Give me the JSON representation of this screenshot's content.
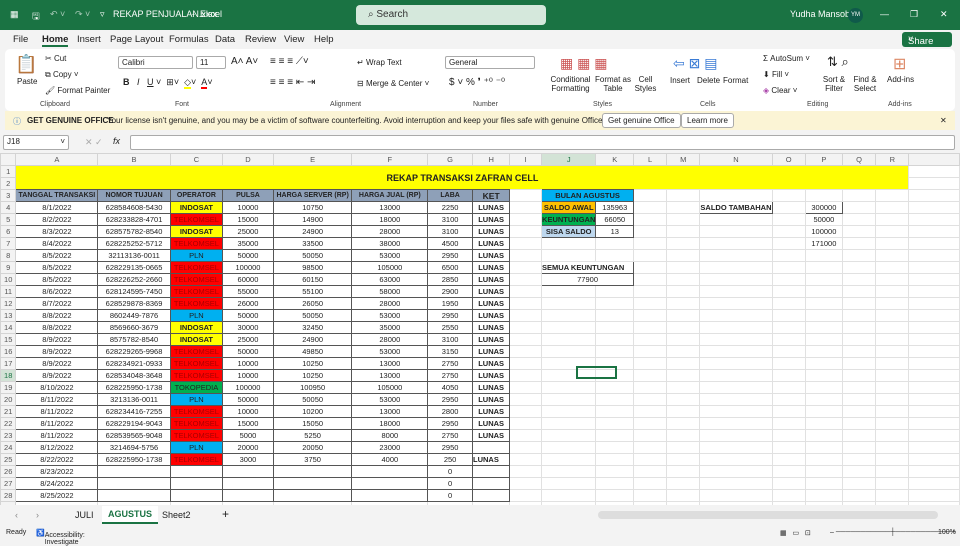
{
  "titlebar": {
    "filename": "REKAP PENJUALAN.xlsx",
    "sep": "-",
    "app": "Excel",
    "search": "Search",
    "user": "Yudha Mansoba",
    "initials": "YM"
  },
  "menu": [
    "File",
    "Home",
    "Insert",
    "Page Layout",
    "Formulas",
    "Data",
    "Review",
    "View",
    "Help"
  ],
  "share": "Share",
  "ribbon": {
    "paste": "Paste",
    "cut": "Cut",
    "copy": "Copy",
    "format_painter": "Format Painter",
    "clipboard": "Clipboard",
    "font_name": "Calibri",
    "font_size": "11",
    "font": "Font",
    "wrap": "Wrap Text",
    "merge": "Merge & Center",
    "alignment": "Alignment",
    "number_format": "General",
    "number": "Number",
    "cond": "Conditional Formatting",
    "fmt_table": "Format as Table",
    "cell_styles": "Cell Styles",
    "styles": "Styles",
    "insert": "Insert",
    "delete": "Delete",
    "format": "Format",
    "cells": "Cells",
    "autosum": "AutoSum",
    "fill": "Fill",
    "clear": "Clear",
    "sort": "Sort & Filter",
    "find": "Find & Select",
    "editing": "Editing",
    "addins": "Add-ins",
    "addins_group": "Add-ins"
  },
  "banner": {
    "title": "GET GENUINE OFFICE",
    "message": "Your license isn't genuine, and you may be a victim of software counterfeiting. Avoid interruption and keep your files safe with genuine Office today.",
    "btn1": "Get genuine Office",
    "btn2": "Learn more"
  },
  "formula": {
    "cell_ref": "J18",
    "fx": "fx",
    "value": ""
  },
  "columns": [
    "A",
    "B",
    "C",
    "D",
    "E",
    "F",
    "G",
    "H",
    "I",
    "J",
    "K",
    "L",
    "M",
    "N",
    "O",
    "P",
    "Q",
    "R"
  ],
  "colors": {
    "INDOSAT": "#ffff00",
    "TELKOMSEL": "#ff0000",
    "PLN": "#00b0f0",
    "TOKOPEDIA": "#00b050",
    "title": "#ffff00",
    "header": "#8ea0b8"
  },
  "sheet": {
    "title": "REKAP TRANSAKSI ZAFRAN CELL",
    "headers": [
      "TANGGAL TRANSAKSI",
      "NOMOR TUJUAN",
      "OPERATOR",
      "PULSA",
      "HARGA SERVER (RP)",
      "HARGA JUAL (RP)",
      "LABA",
      "KET"
    ],
    "rows": [
      [
        "8/1/2022",
        "628584608-5430",
        "INDOSAT",
        "10000",
        "10750",
        "13000",
        "2250",
        "LUNAS"
      ],
      [
        "8/2/2022",
        "628233828-4701",
        "TELKOMSEL",
        "15000",
        "14900",
        "18000",
        "3100",
        "LUNAS"
      ],
      [
        "8/3/2022",
        "628575782-8540",
        "INDOSAT",
        "25000",
        "24900",
        "28000",
        "3100",
        "LUNAS"
      ],
      [
        "8/4/2022",
        "628225252-5712",
        "TELKOMSEL",
        "35000",
        "33500",
        "38000",
        "4500",
        "LUNAS"
      ],
      [
        "8/5/2022",
        "32113136-0011",
        "PLN",
        "50000",
        "50050",
        "53000",
        "2950",
        "LUNAS"
      ],
      [
        "8/5/2022",
        "628229135-0665",
        "TELKOMSEL",
        "100000",
        "98500",
        "105000",
        "6500",
        "LUNAS"
      ],
      [
        "8/5/2022",
        "628226252-2660",
        "TELKOMSEL",
        "60000",
        "60150",
        "63000",
        "2850",
        "LUNAS"
      ],
      [
        "8/6/2022",
        "628124595-7450",
        "TELKOMSEL",
        "55000",
        "55100",
        "58000",
        "2900",
        "LUNAS"
      ],
      [
        "8/7/2022",
        "628529878-8369",
        "TELKOMSEL",
        "26000",
        "26050",
        "28000",
        "1950",
        "LUNAS"
      ],
      [
        "8/8/2022",
        "8602449-7876",
        "PLN",
        "50000",
        "50050",
        "53000",
        "2950",
        "LUNAS"
      ],
      [
        "8/8/2022",
        "8569660-3679",
        "INDOSAT",
        "30000",
        "32450",
        "35000",
        "2550",
        "LUNAS"
      ],
      [
        "8/9/2022",
        "8575782-8540",
        "INDOSAT",
        "25000",
        "24900",
        "28000",
        "3100",
        "LUNAS"
      ],
      [
        "8/9/2022",
        "628229265-9968",
        "TELKOMSEL",
        "50000",
        "49850",
        "53000",
        "3150",
        "LUNAS"
      ],
      [
        "8/9/2022",
        "628234921-0933",
        "TELKOMSEL",
        "10000",
        "10250",
        "13000",
        "2750",
        "LUNAS"
      ],
      [
        "8/9/2022",
        "628534048-3648",
        "TELKOMSEL",
        "10000",
        "10250",
        "13000",
        "2750",
        "LUNAS"
      ],
      [
        "8/10/2022",
        "628225950-1738",
        "TOKOPEDIA",
        "100000",
        "100950",
        "105000",
        "4050",
        "LUNAS"
      ],
      [
        "8/11/2022",
        "3213136-0011",
        "PLN",
        "50000",
        "50050",
        "53000",
        "2950",
        "LUNAS"
      ],
      [
        "8/11/2022",
        "628234416-7255",
        "TELKOMSEL",
        "10000",
        "10200",
        "13000",
        "2800",
        "LUNAS"
      ],
      [
        "8/11/2022",
        "628229194-9043",
        "TELKOMSEL",
        "15000",
        "15050",
        "18000",
        "2950",
        "LUNAS"
      ],
      [
        "8/11/2022",
        "628539565-9048",
        "TELKOMSEL",
        "5000",
        "5250",
        "8000",
        "2750",
        "LUNAS"
      ],
      [
        "8/12/2022",
        "3214694-5756",
        "PLN",
        "20000",
        "20050",
        "23000",
        "2950",
        ""
      ],
      [
        "8/22/2022",
        "628225950-1738",
        "TELKOMSEL",
        "3000",
        "3750",
        "4000",
        "250",
        "LUNAS"
      ],
      [
        "8/23/2022",
        "",
        "",
        "",
        "",
        "",
        "0",
        ""
      ],
      [
        "8/24/2022",
        "",
        "",
        "",
        "",
        "",
        "0",
        ""
      ],
      [
        "8/25/2022",
        "",
        "",
        "",
        "",
        "",
        "0",
        ""
      ]
    ],
    "summary": {
      "month": "BULAN AGUSTUS",
      "saldo_awal_label": "SALDO AWAL",
      "saldo_awal": "135963",
      "keuntungan_label": "KEUNTUNGAN",
      "keuntungan": "66050",
      "sisa_label": "SISA SALDO",
      "sisa": "13",
      "tambahan_label": "SALDO TAMBAHAN",
      "tambahan": [
        "300000",
        "50000",
        "100000",
        "171000"
      ],
      "semua_label": "SEMUA KEUNTUNGAN",
      "semua": "77900"
    }
  },
  "tabs": [
    "JULI",
    "AGUSTUS",
    "Sheet2"
  ],
  "status": {
    "ready": "Ready",
    "accessibility": "Accessibility: Investigate",
    "zoom": "100%"
  }
}
